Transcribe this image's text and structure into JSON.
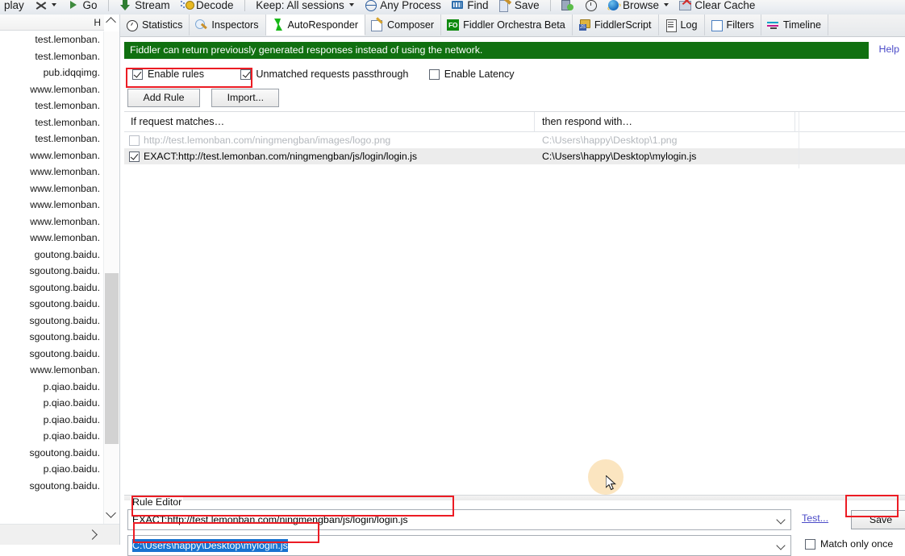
{
  "toolbar": {
    "items": [
      {
        "label": "play",
        "icon": "",
        "id": "replay"
      },
      {
        "label": "",
        "icon": "x-icon",
        "id": "remove",
        "caret": true
      },
      {
        "label": "Go",
        "icon": "play-icon",
        "id": "go"
      },
      {
        "label": "Stream",
        "icon": "stream-icon",
        "id": "stream"
      },
      {
        "label": "Decode",
        "icon": "decode-icon",
        "id": "decode"
      },
      {
        "label": "Keep: All sessions",
        "icon": "",
        "id": "keep-sessions",
        "caret": true
      },
      {
        "label": "Any Process",
        "icon": "globe-icon",
        "id": "any-process"
      },
      {
        "label": "Find",
        "icon": "find-icon",
        "id": "find"
      },
      {
        "label": "Save",
        "icon": "save-icon",
        "id": "save"
      },
      {
        "label": "",
        "icon": "copy-icon",
        "id": "screenshot"
      },
      {
        "label": "",
        "icon": "clock-icon",
        "id": "timer"
      },
      {
        "label": "Browse",
        "icon": "ie-icon",
        "id": "browse",
        "caret": true
      },
      {
        "label": "Clear Cache",
        "icon": "clear-cache-icon",
        "id": "clear-cache"
      }
    ]
  },
  "sessions": {
    "header": "H",
    "items": [
      "test.lemonban.",
      "test.lemonban.",
      "pub.idqqimg.",
      "www.lemonban.",
      "test.lemonban.",
      "test.lemonban.",
      "test.lemonban.",
      "www.lemonban.",
      "www.lemonban.",
      "www.lemonban.",
      "www.lemonban.",
      "www.lemonban.",
      "www.lemonban.",
      "goutong.baidu.",
      "sgoutong.baidu.",
      "sgoutong.baidu.",
      "sgoutong.baidu.",
      "sgoutong.baidu.",
      "sgoutong.baidu.",
      "sgoutong.baidu.",
      "www.lemonban.",
      "p.qiao.baidu.",
      "p.qiao.baidu.",
      "p.qiao.baidu.",
      "p.qiao.baidu.",
      "sgoutong.baidu.",
      "p.qiao.baidu.",
      "sgoutong.baidu."
    ]
  },
  "tabs": [
    {
      "label": "Statistics",
      "icon": "statistics-icon",
      "active": false
    },
    {
      "label": "Inspectors",
      "icon": "inspectors-icon",
      "active": false
    },
    {
      "label": "AutoResponder",
      "icon": "bolt-icon",
      "active": true
    },
    {
      "label": "Composer",
      "icon": "composer-icon",
      "active": false
    },
    {
      "label": "Fiddler Orchestra Beta",
      "icon": "fo-icon",
      "active": false
    },
    {
      "label": "FiddlerScript",
      "icon": "fiddlerscript-icon",
      "active": false
    },
    {
      "label": "Log",
      "icon": "log-icon",
      "active": false
    },
    {
      "label": "Filters",
      "icon": "filters-icon",
      "active": false
    },
    {
      "label": "Timeline",
      "icon": "timeline-icon",
      "active": false
    }
  ],
  "autoresponder": {
    "banner": "Fiddler can return previously generated responses instead of using the network.",
    "help_label": "Help",
    "checkboxes": [
      {
        "label": "Enable rules",
        "checked": true
      },
      {
        "label": "Unmatched requests passthrough",
        "checked": true
      },
      {
        "label": "Enable Latency",
        "checked": false
      }
    ],
    "buttons": {
      "add_rule": "Add Rule",
      "import": "Import..."
    },
    "grid": {
      "col1_header": "If request matches…",
      "col2_header": "then respond with…",
      "rows": [
        {
          "checked": false,
          "enabled": false,
          "selected": false,
          "match": "http://test.lemonban.com/ningmengban/images/logo.png",
          "respond": "C:\\Users\\happy\\Desktop\\1.png"
        },
        {
          "checked": true,
          "enabled": true,
          "selected": true,
          "match": "EXACT:http://test.lemonban.com/ningmengban/js/login/login.js",
          "respond": "C:\\Users\\happy\\Desktop\\mylogin.js"
        }
      ]
    },
    "rule_editor": {
      "title": "Rule Editor",
      "match_value": "EXACT:http://test.lemonban.com/ningmengban/js/login/login.js",
      "respond_value": "C:\\Users\\happy\\Desktop\\mylogin.js",
      "test_label": "Test...",
      "save_label": "Save",
      "match_only_once_label": "Match only once",
      "match_only_once_checked": false
    }
  },
  "colors": {
    "banner_green": "#107010",
    "annotation_red": "#ec1c24",
    "link_blue": "#4b4bc8",
    "selection_blue": "#1673d1"
  }
}
